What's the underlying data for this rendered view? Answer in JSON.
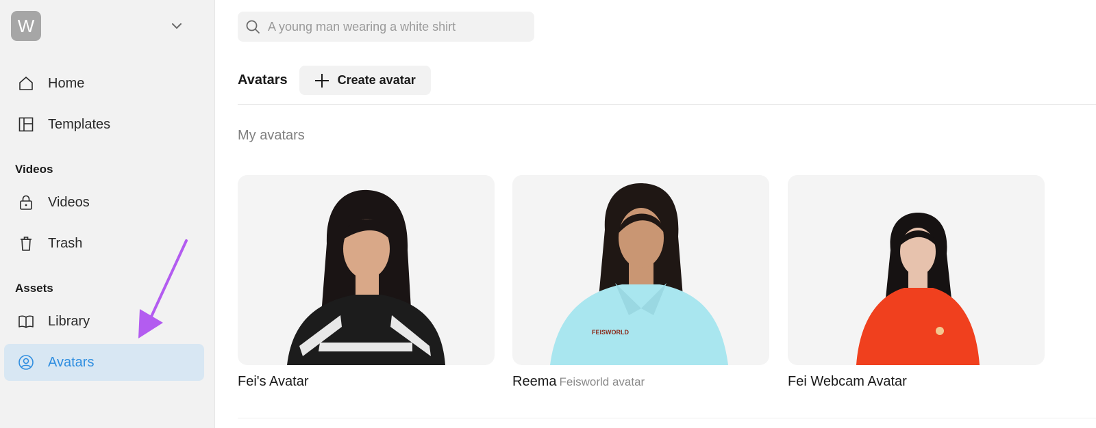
{
  "sidebar": {
    "workspace_initial": "W",
    "nav": [
      {
        "label": "Home",
        "icon": "home-icon"
      },
      {
        "label": "Templates",
        "icon": "templates-icon"
      }
    ],
    "sections": [
      {
        "label": "Videos",
        "items": [
          {
            "label": "Videos",
            "icon": "lock-icon"
          },
          {
            "label": "Trash",
            "icon": "trash-icon"
          }
        ]
      },
      {
        "label": "Assets",
        "items": [
          {
            "label": "Library",
            "icon": "book-icon"
          },
          {
            "label": "Avatars",
            "icon": "avatar-icon",
            "active": true
          }
        ]
      }
    ]
  },
  "search": {
    "placeholder": "A young man wearing a white shirt"
  },
  "header": {
    "title": "Avatars",
    "create_label": "Create avatar"
  },
  "main": {
    "section_title": "My avatars",
    "avatars": [
      {
        "name": "Fei's Avatar",
        "subtitle": "",
        "shirt": "#1c1c1c",
        "hair": "#1a1414",
        "skin": "#d9a888"
      },
      {
        "name": "Reema",
        "subtitle": "Feisworld avatar",
        "shirt": "#a9e6ef",
        "hair": "#1f1714",
        "skin": "#c99673",
        "logo": "FEISWORLD"
      },
      {
        "name": "Fei Webcam Avatar",
        "subtitle": "",
        "shirt": "#f0401e",
        "hair": "#161212",
        "skin": "#e7c2ad"
      }
    ]
  },
  "colors": {
    "accent": "#2f8ee0",
    "active_bg": "#d8e7f3",
    "annotation_arrow": "#b35cf0"
  }
}
